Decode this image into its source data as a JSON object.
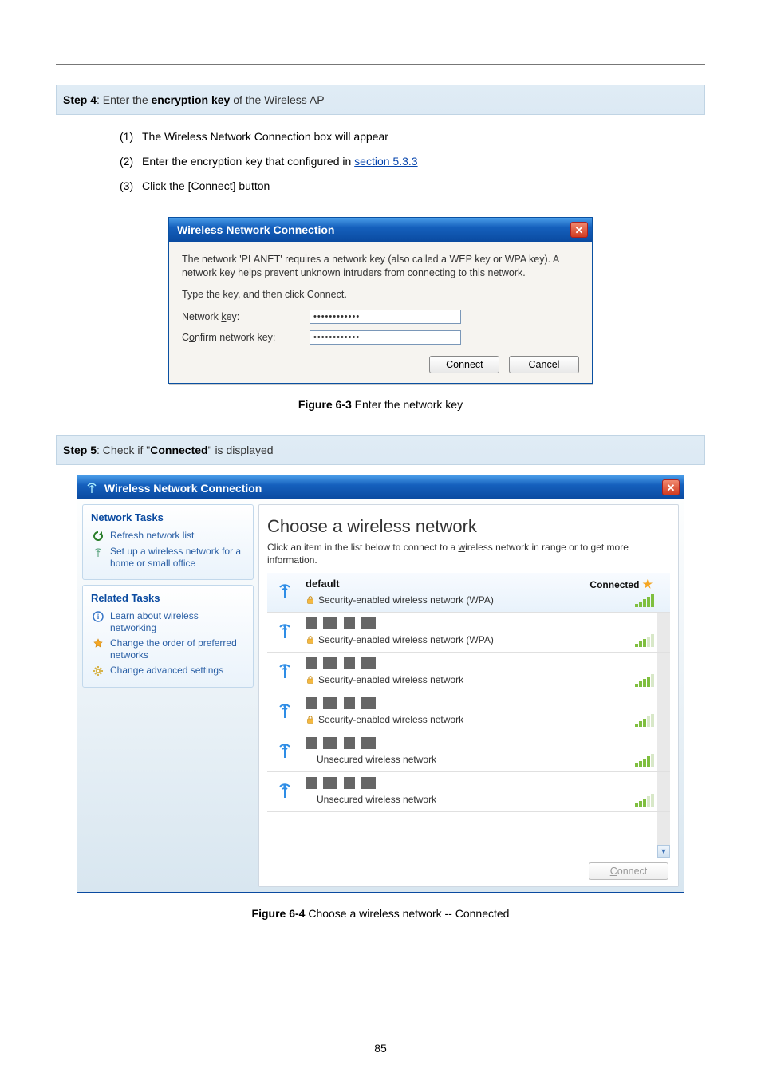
{
  "step4": {
    "label": "Step 4",
    "text_prefix": ": Enter the ",
    "bold": "encryption key",
    "text_suffix": " of the Wireless AP",
    "lines": [
      {
        "n": "(1)",
        "text": "The Wireless Network Connection box will appear"
      },
      {
        "n": "(2)",
        "text": "Enter the encryption key that configured in ",
        "link": "section 5.3.3"
      },
      {
        "n": "(3)",
        "text": "Click the [Connect] button"
      }
    ]
  },
  "keyDialog": {
    "title": "Wireless Network Connection",
    "msg1": "The network 'PLANET' requires a network key (also called a WEP key or WPA key). A network key helps prevent unknown intruders from connecting to this network.",
    "msg2": "Type the key, and then click Connect.",
    "lbl_key_pre": "Network ",
    "lbl_key_u": "k",
    "lbl_key_post": "ey:",
    "lbl_conf_pre": "C",
    "lbl_conf_u": "o",
    "lbl_conf_post": "nfirm network key:",
    "val_key": "••••••••••••",
    "val_conf": "••••••••••••",
    "btn_connect_u": "C",
    "btn_connect_rest": "onnect",
    "btn_cancel": "Cancel"
  },
  "fig63": {
    "bold": "Figure 6-3",
    "rest": " Enter the network key"
  },
  "step5": {
    "label": "Step 5",
    "text_prefix": ": Check if \"",
    "bold": "Connected",
    "text_suffix": "\" is displayed"
  },
  "wlanDialog": {
    "title": "Wireless Network Connection",
    "side1_title": "Network Tasks",
    "link_refresh": "Refresh network list",
    "link_setup": "Set up a wireless network for a home or small office",
    "side2_title": "Related Tasks",
    "link_learn": "Learn about wireless networking",
    "link_order": "Change the order of preferred networks",
    "link_adv": "Change advanced settings",
    "choose_title": "Choose a wireless network",
    "choose_hint_pre": "Click an item in the list below to connect to a ",
    "choose_hint_u": "w",
    "choose_hint_post": "ireless network in range or to get more information.",
    "status_connected": "Connected",
    "connect_btn_u": "C",
    "connect_btn_rest": "onnect",
    "networks": [
      {
        "ssid": "default",
        "security": "Security-enabled wireless network (WPA)",
        "lock": true,
        "signal": "strong",
        "selected": true,
        "connected": true
      },
      {
        "ssid_redacted": true,
        "security": "Security-enabled wireless network (WPA)",
        "lock": true,
        "signal": "weak"
      },
      {
        "ssid_redacted": true,
        "security": "Security-enabled wireless network",
        "lock": true,
        "signal": "mid"
      },
      {
        "ssid_redacted": true,
        "security": "Security-enabled wireless network",
        "lock": true,
        "signal": "weak"
      },
      {
        "ssid_redacted": true,
        "security": "Unsecured wireless network",
        "lock": false,
        "signal": "mid"
      },
      {
        "ssid_redacted": true,
        "security": "Unsecured wireless network",
        "lock": false,
        "signal": "weak"
      }
    ]
  },
  "fig64": {
    "bold": "Figure 6-4",
    "rest": " Choose a wireless network -- Connected"
  },
  "pageNumber": "85"
}
